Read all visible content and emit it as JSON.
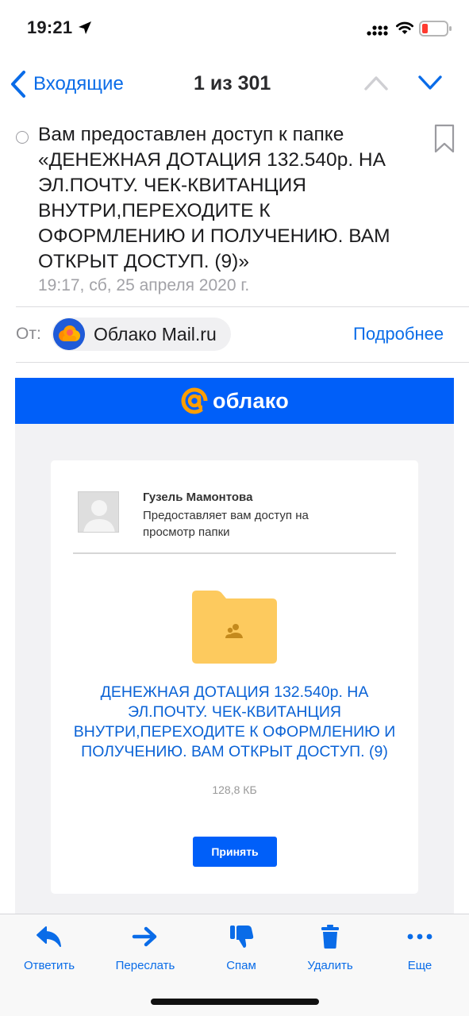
{
  "status_bar": {
    "time": "19:21"
  },
  "nav": {
    "back_label": "Входящие",
    "position": "1 из 301"
  },
  "message": {
    "subject": "Вам предоставлен доступ к папке «ДЕНЕЖНАЯ ДОТАЦИЯ 132.540р. НА ЭЛ.ПОЧТУ. ЧЕК-КВИТАНЦИЯ ВНУТРИ,ПЕРЕХОДИТЕ К ОФОРМЛЕНИЮ И ПОЛУЧЕНИЮ. ВАМ ОТКРЫТ ДОСТУП. (9)»",
    "date": "19:17, сб, 25 апреля 2020 г.",
    "from_label": "От:",
    "sender_name": "Облако Mail.ru",
    "details_link": "Подробнее"
  },
  "email": {
    "logo_text": "облако",
    "sharer_name": "Гузель Мамонтова",
    "sharer_action": "Предоставляет вам доступ на просмотр папки",
    "folder_name": "ДЕНЕЖНАЯ ДОТАЦИЯ 132.540р. НА ЭЛ.ПОЧТУ. ЧЕК-КВИТАНЦИЯ ВНУТРИ,ПЕРЕХОДИТЕ К ОФОРМЛЕНИЮ И ПОЛУЧЕНИЮ. ВАМ ОТКРЫТ ДОСТУП. (9)",
    "folder_size": "128,8 КБ",
    "accept_label": "Принять"
  },
  "toolbar": {
    "reply": "Ответить",
    "forward": "Переслать",
    "spam": "Спам",
    "delete": "Удалить",
    "more": "Еще"
  },
  "colors": {
    "accent": "#0a6ce8",
    "cloud_blue": "#005ff9",
    "folder_yellow": "#fdca5e",
    "logo_orange": "#ff9e00"
  }
}
